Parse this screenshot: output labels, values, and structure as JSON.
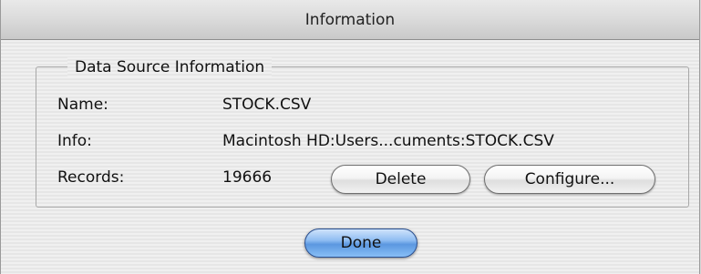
{
  "window": {
    "title": "Information"
  },
  "data_source": {
    "group_title": "Data Source Information",
    "name_label": "Name:",
    "name_value": "STOCK.CSV",
    "info_label": "Info:",
    "info_value": "Macintosh HD:Users...cuments:STOCK.CSV",
    "records_label": "Records:",
    "records_value": "19666"
  },
  "buttons": {
    "delete": "Delete",
    "configure": "Configure...",
    "done": "Done"
  },
  "colors": {
    "default_button": "#5b97e0",
    "window_background": "#ececec"
  }
}
